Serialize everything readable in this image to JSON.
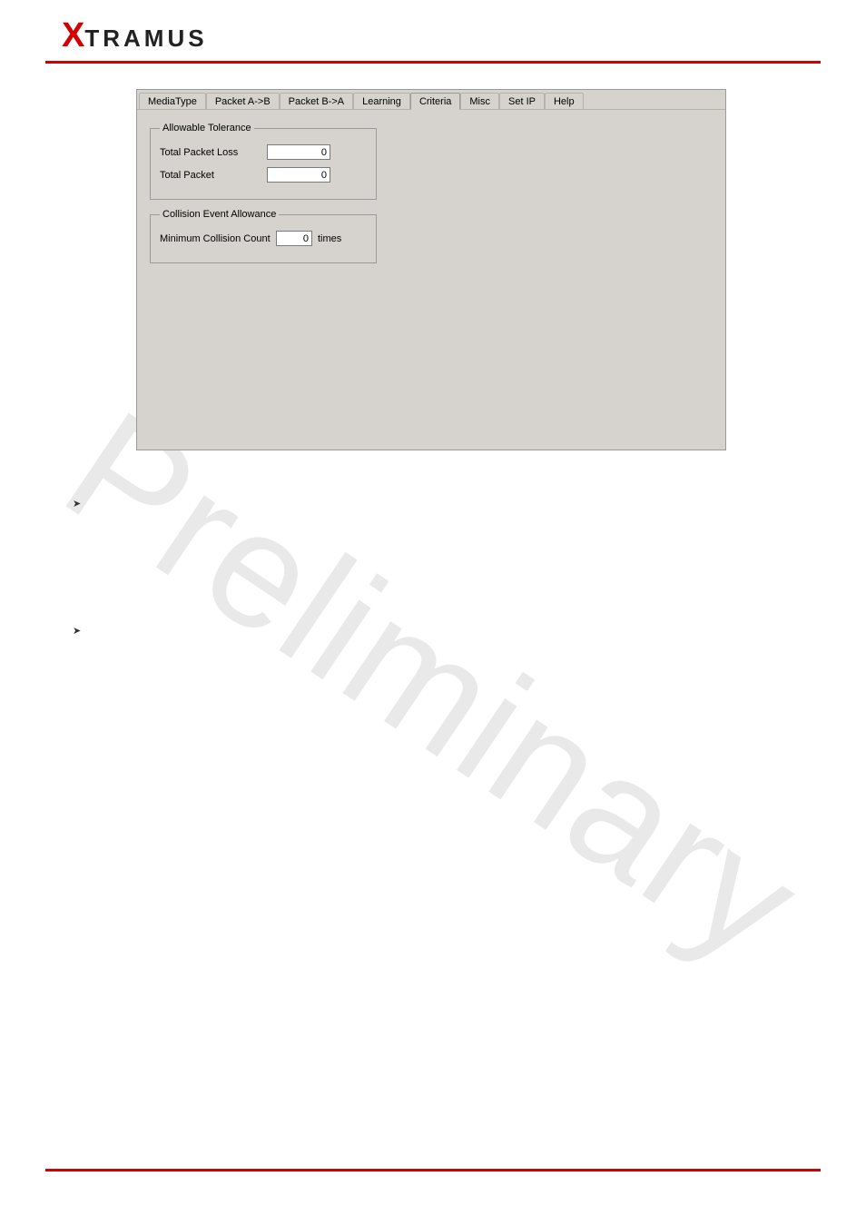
{
  "logo": {
    "x": "X",
    "rest": "TRAMUS"
  },
  "tabs": [
    {
      "label": "MediaType",
      "active": false
    },
    {
      "label": "Packet A->B",
      "active": false
    },
    {
      "label": "Packet B->A",
      "active": false
    },
    {
      "label": "Learning",
      "active": false
    },
    {
      "label": "Criteria",
      "active": true
    },
    {
      "label": "Misc",
      "active": false
    },
    {
      "label": "Set IP",
      "active": false
    },
    {
      "label": "Help",
      "active": false
    }
  ],
  "allowable_tolerance": {
    "legend": "Allowable Tolerance",
    "total_packet_loss_label": "Total Packet Loss",
    "total_packet_loss_value": "0",
    "total_packet_label": "Total Packet",
    "total_packet_value": "0"
  },
  "collision_event_allowance": {
    "legend": "Collision Event Allowance",
    "min_collision_label": "Minimum Collision Count",
    "min_collision_value": "0",
    "unit": "times"
  },
  "watermark_text": "Preliminary"
}
